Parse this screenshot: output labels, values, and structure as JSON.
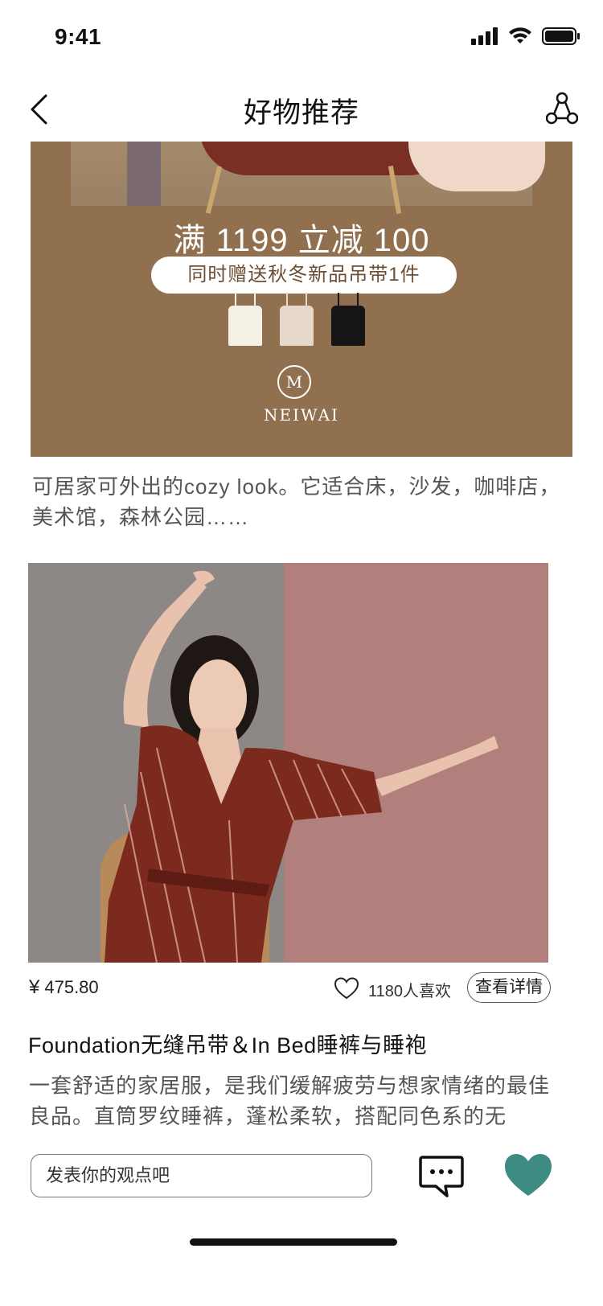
{
  "status_bar": {
    "time": "9:41"
  },
  "nav": {
    "title": "好物推荐"
  },
  "promo": {
    "headline": "满 1199 立减 100",
    "gift": "同时赠送秋冬新品吊带1件",
    "logo_mark": "M",
    "brand": "NEIWAI"
  },
  "caption": "可居家可外出的cozy look。它适合床，沙发，咖啡店，美术馆，森林公园……",
  "product": {
    "currency": "¥",
    "price": "475.80",
    "likes": "1180人喜欢",
    "detail_button": "查看详情",
    "title": "Foundation无缝吊带＆In Bed睡裤与睡袍",
    "description": "一套舒适的家居服，是我们缓解疲劳与想家情绪的最佳良品。直筒罗纹睡裤，蓬松柔软，搭配同色系的无"
  },
  "bottom_bar": {
    "comment_placeholder": "发表你的观点吧"
  },
  "colors": {
    "favorite_accent": "#3d8b82",
    "promo_bg": "#91704f"
  }
}
